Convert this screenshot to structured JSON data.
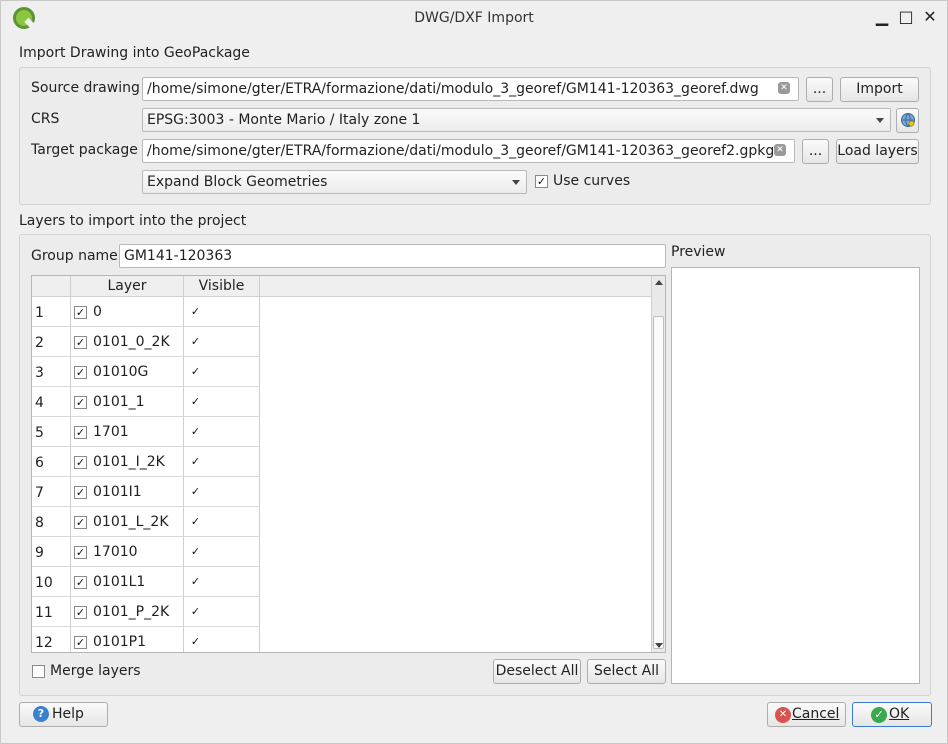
{
  "window": {
    "title": "DWG/DXF Import",
    "minimize": "▁",
    "maximize": "□",
    "close": "✕"
  },
  "import_section": {
    "title": "Import Drawing into GeoPackage",
    "source_label": "Source drawing",
    "source_value": "/home/simone/gter/ETRA/formazione/dati/modulo_3_georef/GM141-120363_georef.dwg",
    "source_browse": "...",
    "import_button": "Import",
    "crs_label": "CRS",
    "crs_value": "EPSG:3003 - Monte Mario / Italy zone 1",
    "target_label": "Target package",
    "target_value": "/home/simone/gter/ETRA/formazione/dati/modulo_3_georef/GM141-120363_georef2.gpkg",
    "target_browse": "...",
    "load_layers_button": "Load layers",
    "block_mode": "Expand Block Geometries",
    "use_curves_label": "Use curves",
    "use_curves_checked": true
  },
  "layers_section": {
    "title": "Layers to import into the project",
    "group_name_label": "Group name",
    "group_name_value": "GM141-120363",
    "preview_label": "Preview",
    "columns": [
      "Layer",
      "Visible"
    ],
    "rows": [
      {
        "num": "1",
        "layer": "0",
        "checked": true,
        "visible": true
      },
      {
        "num": "2",
        "layer": "0101_0_2K",
        "checked": true,
        "visible": true
      },
      {
        "num": "3",
        "layer": "01010G",
        "checked": true,
        "visible": true
      },
      {
        "num": "4",
        "layer": "0101_1",
        "checked": true,
        "visible": true
      },
      {
        "num": "5",
        "layer": "1701",
        "checked": true,
        "visible": true
      },
      {
        "num": "6",
        "layer": "0101_I_2K",
        "checked": true,
        "visible": true
      },
      {
        "num": "7",
        "layer": "0101I1",
        "checked": true,
        "visible": true
      },
      {
        "num": "8",
        "layer": "0101_L_2K",
        "checked": true,
        "visible": true
      },
      {
        "num": "9",
        "layer": "17010",
        "checked": true,
        "visible": true
      },
      {
        "num": "10",
        "layer": "0101L1",
        "checked": true,
        "visible": true
      },
      {
        "num": "11",
        "layer": "0101_P_2K",
        "checked": true,
        "visible": true
      },
      {
        "num": "12",
        "layer": "0101P1",
        "checked": true,
        "visible": true
      }
    ],
    "merge_layers_label": "Merge layers",
    "merge_layers_checked": false,
    "deselect_all": "Deselect All",
    "select_all": "Select All"
  },
  "footer": {
    "help": "Help",
    "cancel": "Cancel",
    "ok": "OK"
  },
  "colors": {
    "accent_green": "#589632",
    "help_blue": "#3b7fd0",
    "cancel_red": "#d9534f",
    "ok_border": "#3a7bd5"
  }
}
